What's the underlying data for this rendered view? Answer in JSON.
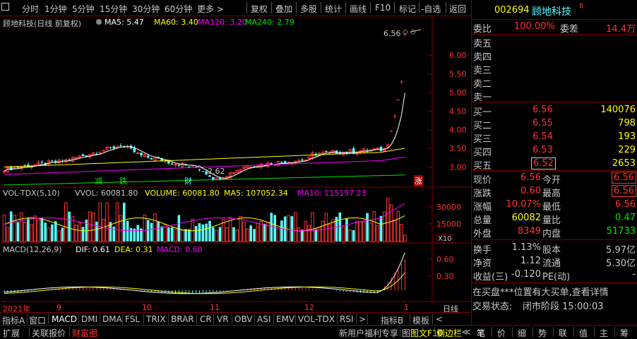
{
  "toolbar": {
    "items": [
      "分时",
      "1分钟",
      "5分钟",
      "15分钟",
      "30分钟",
      "60分钟",
      "更多 >"
    ],
    "right_items": [
      "复权",
      "叠加",
      "多股",
      "统计",
      "画线",
      "F10",
      "标记",
      "-自选",
      "返回"
    ]
  },
  "kline": {
    "title": "顾地科技(日线 前复权)",
    "ma5": "MA5: 5.47",
    "ma60": "MA60: 3.40",
    "ma120": "MA120: 3.20",
    "ma240": "MA240: 2.79",
    "high_label": "6.56",
    "low_label": "2.62",
    "markers": [
      "减",
      "跌",
      "财",
      "涨"
    ],
    "y_ticks": [
      "6.00",
      "5.50",
      "5.00",
      "4.50",
      "4.00",
      "3.50",
      "3.00"
    ]
  },
  "volume": {
    "title": "VOL-TDX(5,10)",
    "vvol": "VVOL: 60081.80",
    "volume": "VOLUME: 60081.80",
    "ma5": "MA5: 107052.34",
    "ma10": "MA10: 115197.23",
    "y_ticks": [
      "30000",
      "15000"
    ],
    "unit": "X10"
  },
  "macd": {
    "title": "MACD(12,26,9)",
    "dif": "DIF: 0.61",
    "dea": "DEA: 0.31",
    "macd": "MACD: 0.60",
    "y_ticks": [
      "0.60",
      "0.30"
    ]
  },
  "x_axis": {
    "labels": [
      "2021年",
      "9",
      "10",
      "11",
      "12",
      "1"
    ],
    "period": "日线"
  },
  "tabs_row1": [
    "指标A",
    "窗口",
    "MACD",
    "DMI",
    "DMA",
    "FSL",
    "TRIX",
    "BRAR",
    "CR",
    "VR",
    "OBV",
    "ASI",
    "EMV",
    "VOL-TDX",
    "RSI",
    ">",
    "指标B",
    "模板",
    "<"
  ],
  "tabs_row2": [
    "扩展",
    "关联报价",
    "财富圈"
  ],
  "promo": {
    "text": "新用户福利专享",
    "b": "指标B",
    "f10": "图文F10",
    "side": "侧边栏"
  },
  "quote": {
    "code": "002694",
    "name": "顾地科技",
    "badge": "B",
    "weibi_label": "委比",
    "weibi": "100.00%",
    "weicha_label": "委差",
    "weicha": "14.4万",
    "sell": [
      {
        "label": "卖五",
        "price": "",
        "vol": ""
      },
      {
        "label": "卖四",
        "price": "",
        "vol": ""
      },
      {
        "label": "卖三",
        "price": "",
        "vol": ""
      },
      {
        "label": "卖二",
        "price": "",
        "vol": ""
      },
      {
        "label": "卖一",
        "price": "",
        "vol": ""
      }
    ],
    "buy": [
      {
        "label": "买一",
        "price": "6.56",
        "vol": "140076"
      },
      {
        "label": "买二",
        "price": "6.55",
        "vol": "798"
      },
      {
        "label": "买三",
        "price": "6.54",
        "vol": "193"
      },
      {
        "label": "买四",
        "price": "6.53",
        "vol": "229"
      },
      {
        "label": "买五",
        "price": "6.52",
        "vol": "2653"
      }
    ],
    "stats": [
      {
        "l1": "现价",
        "v1": "6.56",
        "l2": "今开",
        "v2": "6.56",
        "c1": "#ff3232",
        "c2": "#ff3232",
        "box2": true
      },
      {
        "l1": "涨跌",
        "v1": "0.60",
        "l2": "最高",
        "v2": "6.56",
        "c1": "#ff3232",
        "c2": "#ff3232",
        "box2": true
      },
      {
        "l1": "涨幅",
        "v1": "10.07%",
        "l2": "最低",
        "v2": "6.56",
        "c1": "#ff3232",
        "c2": "#ff3232",
        "box2": false
      },
      {
        "l1": "总量",
        "v1": "60082",
        "l2": "量比",
        "v2": "0.47",
        "c1": "#ffff00",
        "c2": "#00e600",
        "box2": false
      },
      {
        "l1": "外盘",
        "v1": "8349",
        "l2": "内盘",
        "v2": "51733",
        "c1": "#ff3232",
        "c2": "#00e600",
        "box2": false
      }
    ],
    "stats2": [
      {
        "l1": "换手",
        "v1": "1.13%",
        "l2": "股本",
        "v2": "5.97亿"
      },
      {
        "l1": "净资",
        "v1": "1.12",
        "l2": "流通",
        "v2": "5.30亿"
      },
      {
        "l1": "收益(三)",
        "v1": "-0.120",
        "l2": "PE(动)",
        "v2": "-"
      }
    ],
    "notice": "在买盘***位置有大买单,查看详情",
    "status_label": "交易状态:",
    "status": "闭市阶段 15:00:03"
  },
  "panel_tabs": [
    "笔",
    "价",
    "细",
    "势",
    "联",
    "值",
    "主",
    "筹"
  ],
  "colors": {
    "up": "#ff3232",
    "down": "#54ffff",
    "ma5": "#ffffff",
    "ma60": "#ffff00",
    "ma120": "#ff00ff",
    "ma240": "#00e600",
    "border": "#7f0000"
  },
  "chart_data": {
    "type": "candlestick",
    "title": "顾地科技(日线 前复权)",
    "price_ylim": [
      2.5,
      6.7
    ],
    "x_labels": [
      "2021年",
      "9",
      "10",
      "11",
      "12",
      "1"
    ],
    "last_close": 6.56,
    "period_high": 6.56,
    "period_low": 2.62,
    "ma_lines": {
      "MA5": 5.47,
      "MA60": 3.4,
      "MA120": 3.2,
      "MA240": 2.79
    },
    "volume_last": 60081.8,
    "volume_ma5": 107052.34,
    "volume_ma10": 115197.23,
    "macd": {
      "DIF": 0.61,
      "DEA": 0.31,
      "MACD": 0.6
    }
  }
}
